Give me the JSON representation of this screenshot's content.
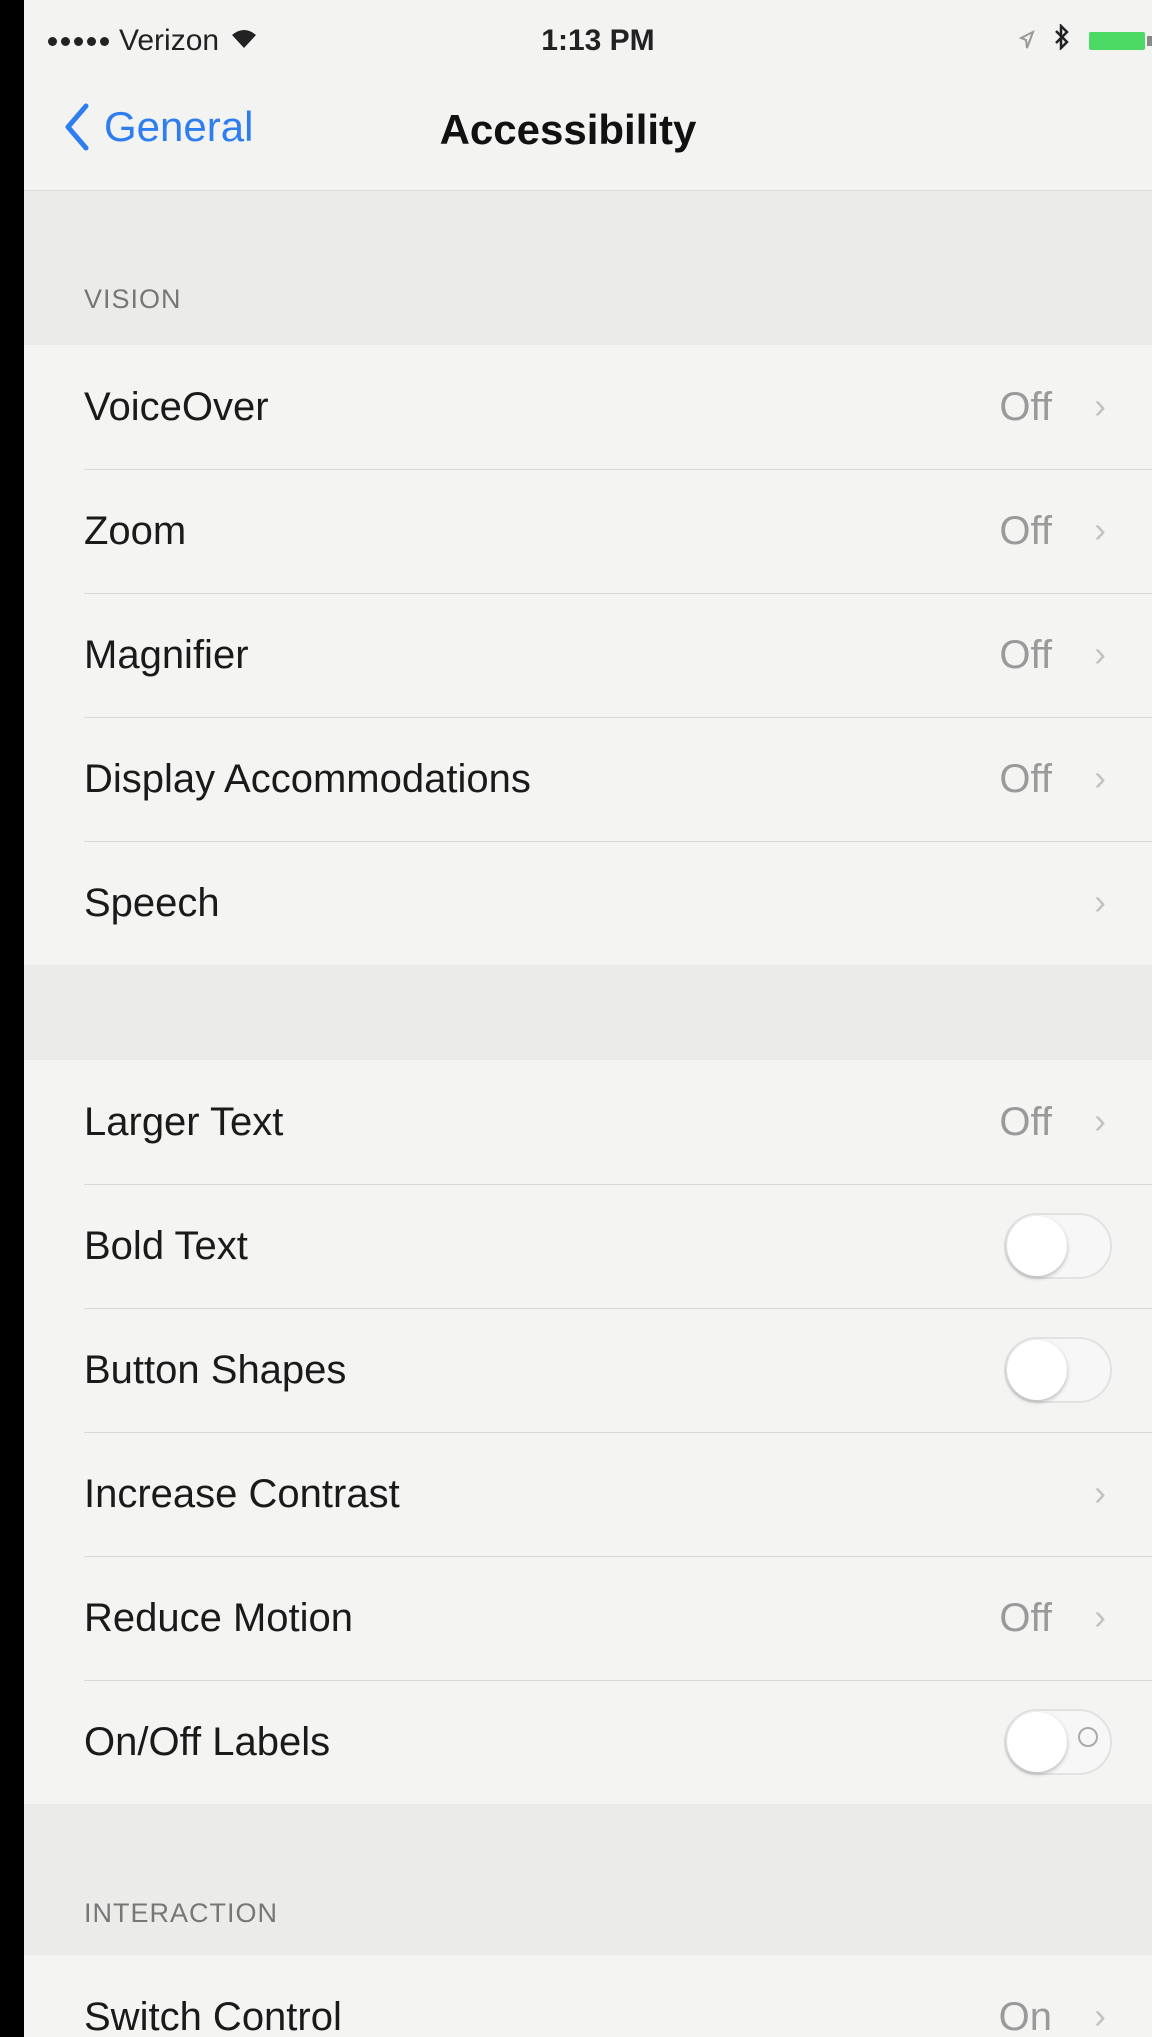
{
  "status_bar": {
    "carrier": "Verizon",
    "time": "1:13 PM"
  },
  "nav": {
    "back_label": "General",
    "title": "Accessibility"
  },
  "sections": {
    "vision_header": "VISION",
    "interaction_header": "INTERACTION"
  },
  "vision_items": [
    {
      "label": "VoiceOver",
      "value": "Off"
    },
    {
      "label": "Zoom",
      "value": "Off"
    },
    {
      "label": "Magnifier",
      "value": "Off"
    },
    {
      "label": "Display Accommodations",
      "value": "Off"
    },
    {
      "label": "Speech",
      "value": ""
    }
  ],
  "text_items": {
    "larger_text": {
      "label": "Larger Text",
      "value": "Off"
    },
    "bold_text": {
      "label": "Bold Text",
      "toggle": false
    },
    "button_shapes": {
      "label": "Button Shapes",
      "toggle": false
    },
    "increase_contrast": {
      "label": "Increase Contrast",
      "value": ""
    },
    "reduce_motion": {
      "label": "Reduce Motion",
      "value": "Off"
    },
    "onoff_labels": {
      "label": "On/Off Labels",
      "toggle": false
    }
  },
  "interaction_items": [
    {
      "label": "Switch Control",
      "value": "On"
    }
  ],
  "icons": {
    "back": "chevron-left-icon",
    "disclosure": "chevron-right-icon",
    "wifi": "wifi-icon",
    "moon": "moon-icon",
    "bluetooth": "bluetooth-icon",
    "battery": "battery-icon"
  },
  "colors": {
    "accent": "#2e7ef0",
    "battery": "#4cd964"
  }
}
